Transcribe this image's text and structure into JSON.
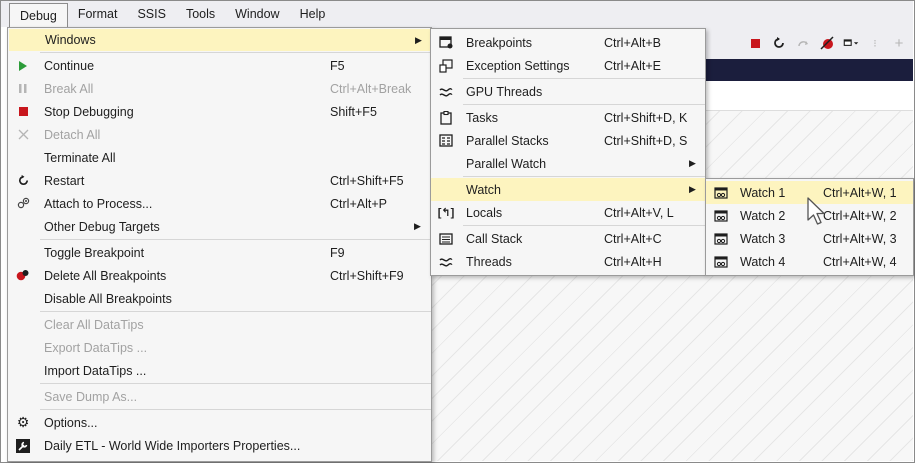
{
  "menubar": {
    "items": [
      "Debug",
      "Format",
      "SSIS",
      "Tools",
      "Window",
      "Help"
    ]
  },
  "colors": {
    "highlight": "#fdf4bf",
    "menu_bg": "#f6f6f6",
    "menubar_bg": "#eeeef2",
    "dark_bar": "#1b1e3d",
    "play_green": "#2c9c39",
    "stop_red": "#c8161d"
  },
  "debug_menu": {
    "items": [
      {
        "label": "Windows",
        "shortcut": "",
        "icon": "none",
        "submenu": true,
        "highlighted": true
      },
      {
        "label": "Continue",
        "shortcut": "F5",
        "icon": "play-icon"
      },
      {
        "label": "Break All",
        "shortcut": "Ctrl+Alt+Break",
        "icon": "pause-icon",
        "disabled": true
      },
      {
        "label": "Stop Debugging",
        "shortcut": "Shift+F5",
        "icon": "stop-icon"
      },
      {
        "label": "Detach All",
        "shortcut": "",
        "icon": "x-icon",
        "disabled": true
      },
      {
        "label": "Terminate All",
        "shortcut": "",
        "icon": "none"
      },
      {
        "label": "Restart",
        "shortcut": "Ctrl+Shift+F5",
        "icon": "restart-icon"
      },
      {
        "label": "Attach to Process...",
        "shortcut": "Ctrl+Alt+P",
        "icon": "attach-icon"
      },
      {
        "label": "Other Debug Targets",
        "shortcut": "",
        "icon": "none",
        "submenu": true
      },
      {
        "label": "Toggle Breakpoint",
        "shortcut": "F9",
        "icon": "none"
      },
      {
        "label": "Delete All Breakpoints",
        "shortcut": "Ctrl+Shift+F9",
        "icon": "delete-breakpoints-icon"
      },
      {
        "label": "Disable All Breakpoints",
        "shortcut": "",
        "icon": "none"
      },
      {
        "label": "Clear All DataTips",
        "shortcut": "",
        "icon": "none",
        "disabled": true
      },
      {
        "label": "Export DataTips ...",
        "shortcut": "",
        "icon": "none",
        "disabled": true
      },
      {
        "label": "Import DataTips ...",
        "shortcut": "",
        "icon": "none"
      },
      {
        "label": "Save Dump As...",
        "shortcut": "",
        "icon": "none",
        "disabled": true
      },
      {
        "label": "Options...",
        "shortcut": "",
        "icon": "gear-icon"
      },
      {
        "label": "Daily ETL - World Wide Importers Properties...",
        "shortcut": "",
        "icon": "wrench-icon"
      }
    ]
  },
  "windows_menu": {
    "items": [
      {
        "label": "Breakpoints",
        "shortcut": "Ctrl+Alt+B",
        "icon": "breakpoints-window-icon"
      },
      {
        "label": "Exception Settings",
        "shortcut": "Ctrl+Alt+E",
        "icon": "exception-settings-icon"
      },
      {
        "label": "GPU Threads",
        "shortcut": "",
        "icon": "gpu-threads-icon"
      },
      {
        "label": "Tasks",
        "shortcut": "Ctrl+Shift+D, K",
        "icon": "tasks-icon"
      },
      {
        "label": "Parallel Stacks",
        "shortcut": "Ctrl+Shift+D, S",
        "icon": "parallel-stacks-icon"
      },
      {
        "label": "Parallel Watch",
        "shortcut": "",
        "icon": "none",
        "submenu": true
      },
      {
        "label": "Watch",
        "shortcut": "",
        "icon": "none",
        "submenu": true,
        "highlighted": true
      },
      {
        "label": "Locals",
        "shortcut": "Ctrl+Alt+V, L",
        "icon": "locals-icon"
      },
      {
        "label": "Call Stack",
        "shortcut": "Ctrl+Alt+C",
        "icon": "call-stack-icon"
      },
      {
        "label": "Threads",
        "shortcut": "Ctrl+Alt+H",
        "icon": "threads-icon"
      }
    ]
  },
  "watch_menu": {
    "items": [
      {
        "label": "Watch 1",
        "shortcut": "Ctrl+Alt+W, 1",
        "icon": "watch-icon",
        "highlighted": true
      },
      {
        "label": "Watch 2",
        "shortcut": "Ctrl+Alt+W, 2",
        "icon": "watch-icon"
      },
      {
        "label": "Watch 3",
        "shortcut": "Ctrl+Alt+W, 3",
        "icon": "watch-icon"
      },
      {
        "label": "Watch 4",
        "shortcut": "Ctrl+Alt+W, 4",
        "icon": "watch-icon"
      }
    ]
  }
}
